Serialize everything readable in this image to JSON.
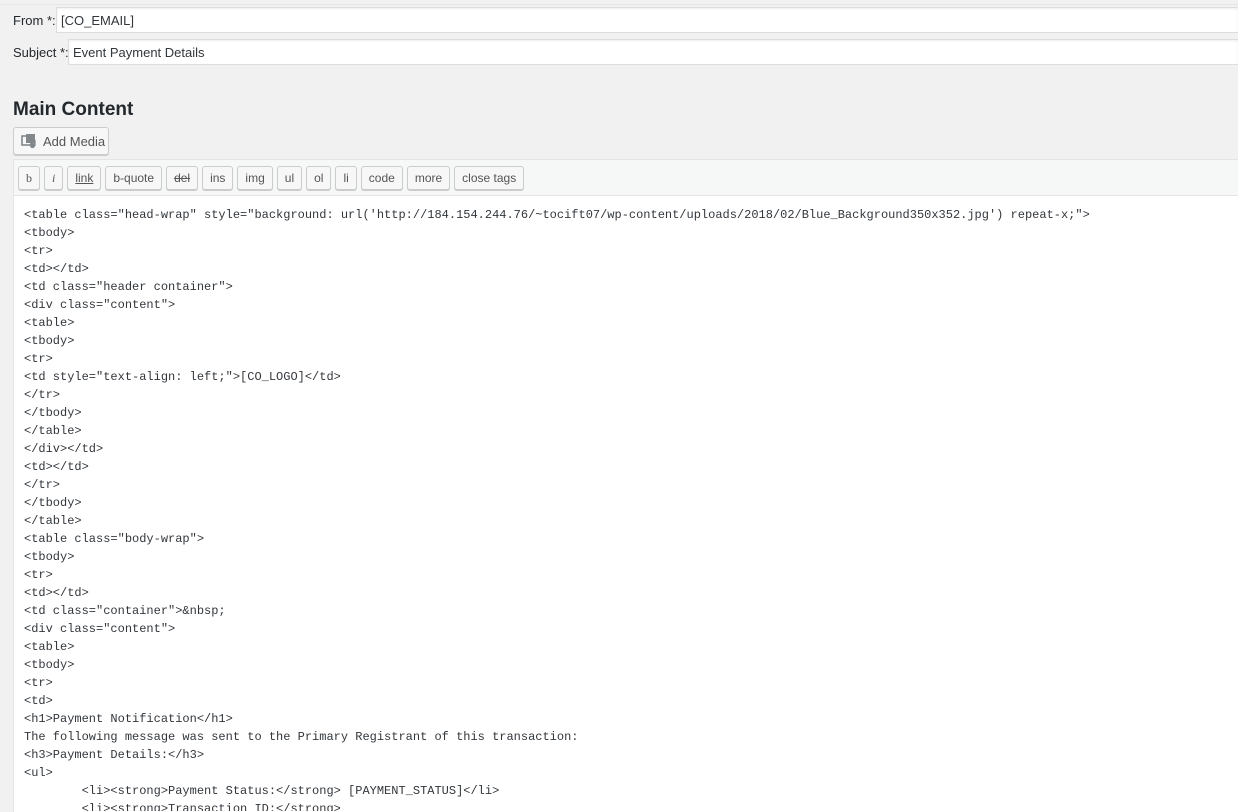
{
  "fields": {
    "from": {
      "label": "From *:",
      "value": "[CO_EMAIL]"
    },
    "subject": {
      "label": "Subject *:",
      "value": "Event Payment Details"
    }
  },
  "main_content": {
    "title": "Main Content",
    "add_media_label": "Add Media",
    "add_media_icon": "media-icon"
  },
  "toolbar": {
    "buttons": [
      "b",
      "i",
      "link",
      "b-quote",
      "del",
      "ins",
      "img",
      "ul",
      "ol",
      "li",
      "code",
      "more",
      "close tags"
    ]
  },
  "editor": {
    "lines": [
      "<table class=\"head-wrap\" style=\"background: url('http://184.154.244.76/~tocift07/wp-content/uploads/2018/02/Blue_Background350x352.jpg') repeat-x;\">",
      "<tbody>",
      "<tr>",
      "<td></td>",
      "<td class=\"header container\">",
      "<div class=\"content\">",
      "<table>",
      "<tbody>",
      "<tr>",
      "<td style=\"text-align: left;\">[CO_LOGO]</td>",
      "</tr>",
      "</tbody>",
      "</table>",
      "</div></td>",
      "<td></td>",
      "</tr>",
      "</tbody>",
      "</table>",
      "<table class=\"body-wrap\">",
      "<tbody>",
      "<tr>",
      "<td></td>",
      "<td class=\"container\">&nbsp;",
      "<div class=\"content\">",
      "<table>",
      "<tbody>",
      "<tr>",
      "<td>",
      "<h1>Payment Notification</h1>",
      "The following message was sent to the Primary Registrant of this transaction:",
      "<h3>Payment Details:</h3>",
      "<ul>",
      "        <li><strong>Payment Status:</strong> [PAYMENT_STATUS]</li>",
      "        <li><strong>Transaction ID:</strong>"
    ]
  }
}
